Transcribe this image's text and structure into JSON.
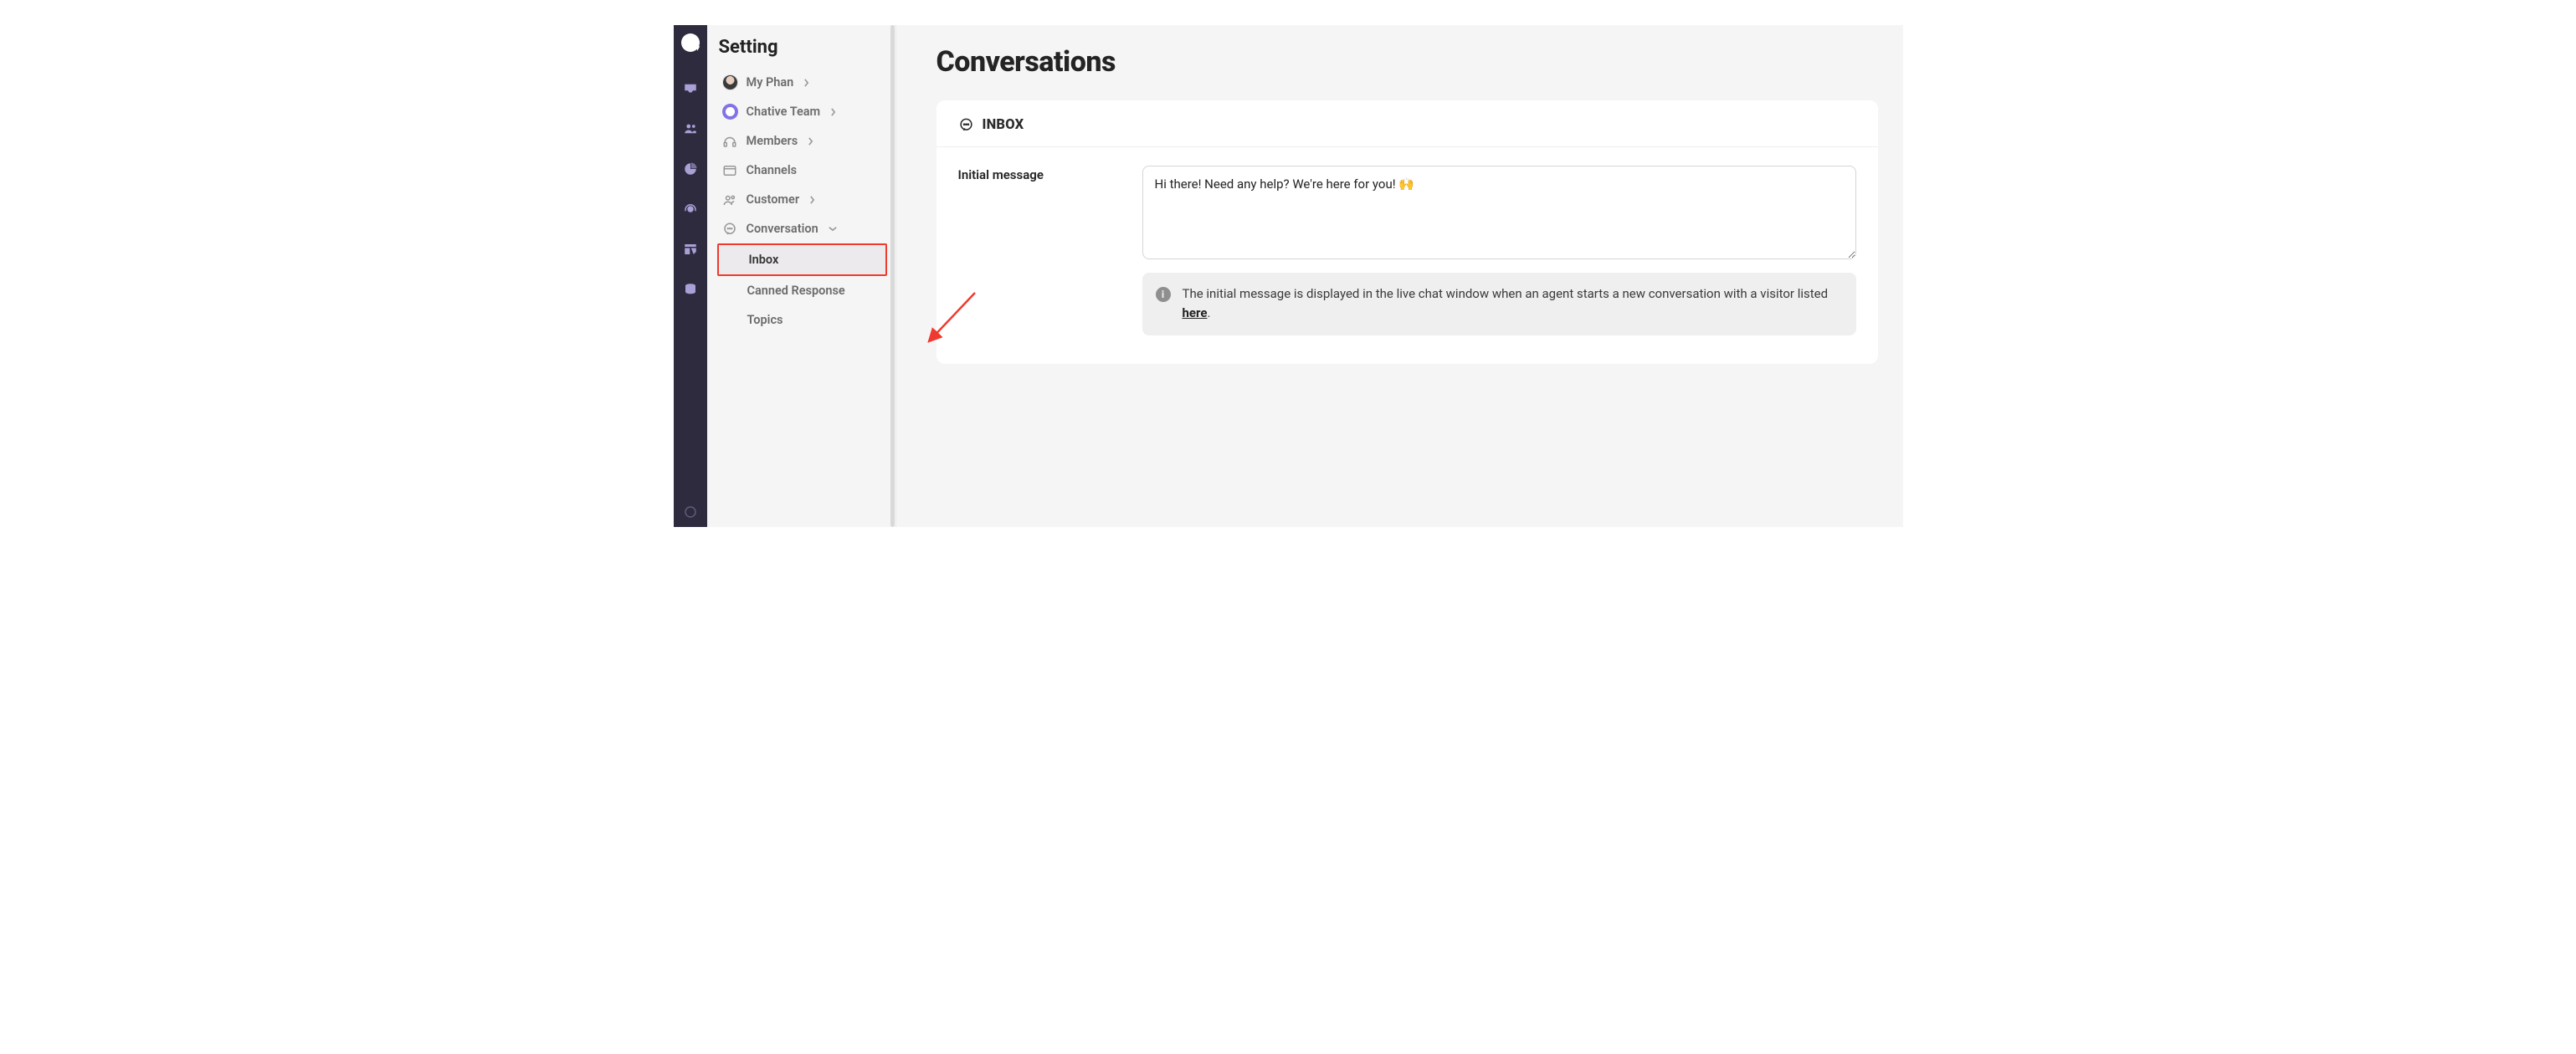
{
  "panel": {
    "title": "Setting",
    "user": {
      "name": "My Phan"
    },
    "team": {
      "name": "Chative Team"
    },
    "items": {
      "members": "Members",
      "channels": "Channels",
      "customer": "Customer",
      "conversation": "Conversation"
    },
    "conversation_sub": {
      "inbox": "Inbox",
      "canned_response": "Canned Response",
      "topics": "Topics"
    }
  },
  "main": {
    "page_title": "Conversations",
    "card_title": "INBOX",
    "field_label": "Initial message",
    "initial_message_value": "Hi there! Need any help? We're here for you! 🙌",
    "info_text_before": "The initial message is displayed in the live chat window when an agent starts a new conversation with a visitor listed ",
    "info_link": "here",
    "info_text_after": "."
  }
}
